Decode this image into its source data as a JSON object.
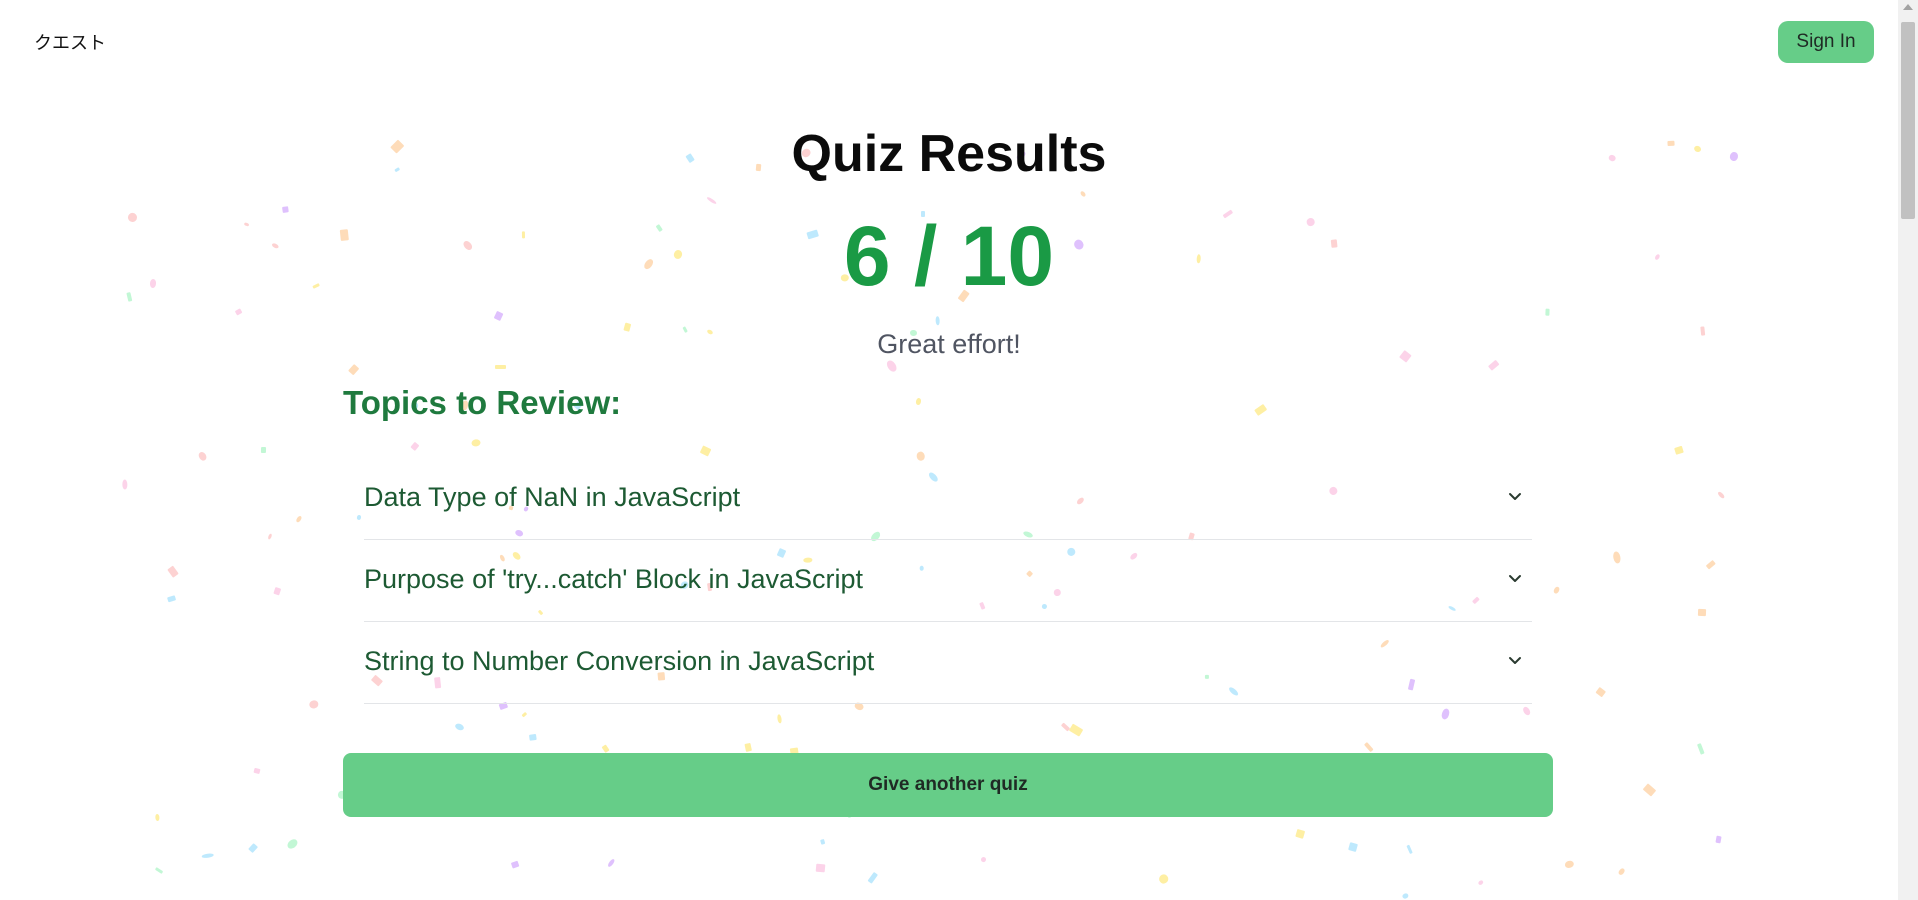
{
  "header": {
    "brand": "クエスト",
    "sign_in_label": "Sign In"
  },
  "results": {
    "title": "Quiz Results",
    "score": "6 / 10",
    "feedback": "Great effort!"
  },
  "topics": {
    "heading": "Topics to Review:",
    "items": [
      {
        "label": "Data Type of NaN in JavaScript"
      },
      {
        "label": "Purpose of 'try...catch' Block in JavaScript"
      },
      {
        "label": "String to Number Conversion in JavaScript"
      }
    ]
  },
  "actions": {
    "retry_label": "Give another quiz"
  },
  "icons": {
    "accordion": "chevron-down-icon",
    "decoration": "confetti"
  },
  "colors": {
    "accent": "#66cd88",
    "score": "#1a9a45",
    "topic_heading": "#1f7a3e",
    "topic_text": "#1d5a33"
  }
}
